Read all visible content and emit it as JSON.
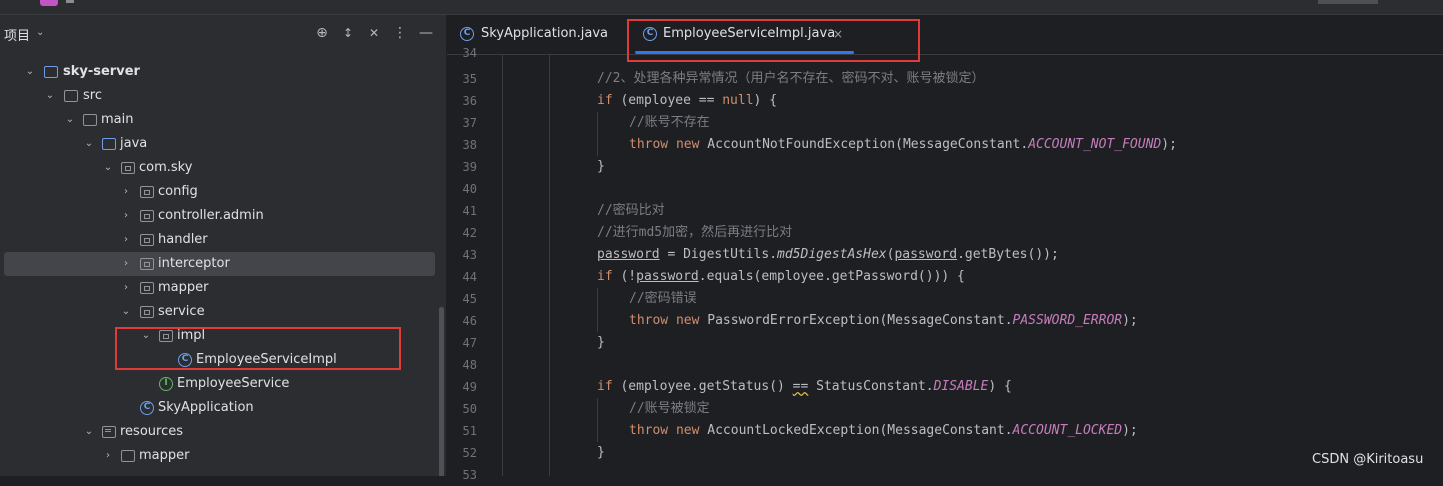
{
  "project_panel": {
    "title": "项目",
    "tree": [
      {
        "label": "sky-server",
        "icon": "module-folder-icon",
        "expanded": true,
        "bold": true
      },
      {
        "label": "src",
        "icon": "folder-icon",
        "expanded": true
      },
      {
        "label": "main",
        "icon": "folder-icon",
        "expanded": true
      },
      {
        "label": "java",
        "icon": "source-folder-icon",
        "expanded": true
      },
      {
        "label": "com.sky",
        "icon": "package-icon",
        "expanded": true
      },
      {
        "label": "config",
        "icon": "package-icon",
        "expanded": false
      },
      {
        "label": "controller.admin",
        "icon": "package-icon",
        "expanded": false
      },
      {
        "label": "handler",
        "icon": "package-icon",
        "expanded": false
      },
      {
        "label": "interceptor",
        "icon": "package-icon",
        "expanded": false,
        "selected": true
      },
      {
        "label": "mapper",
        "icon": "package-icon",
        "expanded": false
      },
      {
        "label": "service",
        "icon": "package-icon",
        "expanded": true
      },
      {
        "label": "impl",
        "icon": "package-icon",
        "expanded": true
      },
      {
        "label": "EmployeeServiceImpl",
        "icon": "class-icon"
      },
      {
        "label": "EmployeeService",
        "icon": "interface-icon"
      },
      {
        "label": "SkyApplication",
        "icon": "spring-class-icon"
      },
      {
        "label": "resources",
        "icon": "resources-folder-icon",
        "expanded": true
      },
      {
        "label": "mapper",
        "icon": "folder-icon",
        "expanded": false
      }
    ]
  },
  "editor": {
    "tabs": [
      {
        "label": "SkyApplication.java",
        "active": false
      },
      {
        "label": "EmployeeServiceImpl.java",
        "active": true,
        "close": "×"
      }
    ],
    "line_numbers": [
      "34",
      "35",
      "36",
      "37",
      "38",
      "39",
      "40",
      "41",
      "42",
      "43",
      "44",
      "45",
      "46",
      "47",
      "48",
      "49",
      "50",
      "51",
      "52",
      "53"
    ],
    "code": {
      "l35": "//2、处理各种异常情况（用户名不存在、密码不对、账号被锁定）",
      "l36_kw": "if",
      "l36_a": " (employee == ",
      "l36_null": "null",
      "l36_b": ") {",
      "l37": "//账号不存在",
      "l38_kw1": "throw",
      "l38_kw2": "new",
      "l38_a": " AccountNotFoundException(MessageConstant.",
      "l38_c": "ACCOUNT_NOT_FOUND",
      "l38_b": ");",
      "l39": "}",
      "l41": "//密码比对",
      "l42": "//进行md5加密，然后再进行比对",
      "l43_v": "password",
      "l43_a": " = DigestUtils.",
      "l43_m": "md5DigestAsHex",
      "l43_b": "(",
      "l43_v2": "password",
      "l43_c": ".getBytes());",
      "l44_kw": "if",
      "l44_a": " (!",
      "l44_v": "password",
      "l44_b": ".equals(employee.getPassword())) {",
      "l45": "//密码错误",
      "l46_kw1": "throw",
      "l46_kw2": "new",
      "l46_a": " PasswordErrorException(MessageConstant.",
      "l46_c": "PASSWORD_ERROR",
      "l46_b": ");",
      "l47": "}",
      "l49_kw": "if",
      "l49_a": " (employee.getStatus() ",
      "l49_eq": "==",
      "l49_b": " StatusConstant.",
      "l49_c": "DISABLE",
      "l49_d": ") {",
      "l50": "//账号被锁定",
      "l51_kw1": "throw",
      "l51_kw2": "new",
      "l51_a": " AccountLockedException(MessageConstant.",
      "l51_c": "ACCOUNT_LOCKED",
      "l51_b": ");",
      "l52": "}"
    }
  },
  "watermark": "CSDN @Kiritoasu",
  "colors": {
    "keyword": "#cf8e6d",
    "comment": "#7a7e85",
    "constant": "#c77dbb",
    "highlight_box": "#e03a3a",
    "tab_underline": "#3574f0"
  }
}
